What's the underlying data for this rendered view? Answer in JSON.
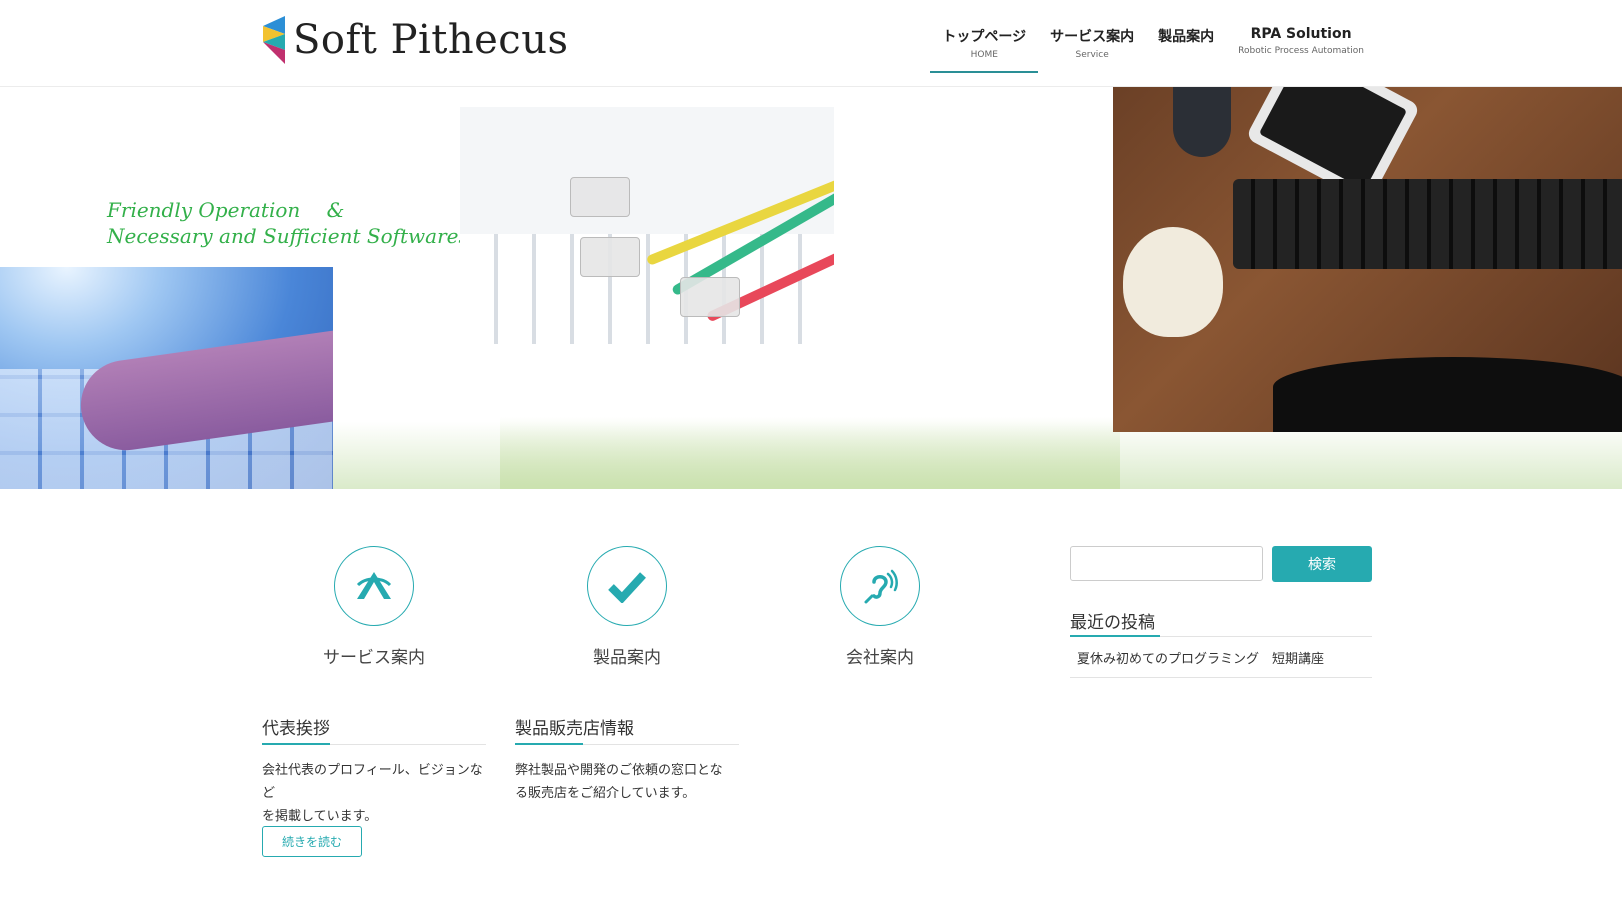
{
  "header": {
    "logo_text": "Soft Pithecus",
    "nav": [
      {
        "main": "トップページ",
        "sub": "HOME",
        "active": true
      },
      {
        "main": "サービス案内",
        "sub": "Service",
        "active": false
      },
      {
        "main": "製品案内",
        "sub": "",
        "active": false
      },
      {
        "main": "RPA Solution",
        "sub": "Robotic Process Automation",
        "active": false
      }
    ]
  },
  "hero": {
    "tagline_line1": "Friendly Operation　 &",
    "tagline_line2": "Necessary and Sufficient Softwares"
  },
  "features": [
    {
      "label": "サービス案内",
      "icon": "triangle-logo-icon"
    },
    {
      "label": "製品案内",
      "icon": "checkmark-icon"
    },
    {
      "label": "会社案内",
      "icon": "hearing-icon"
    }
  ],
  "widgets": {
    "greeting": {
      "title": "代表挨拶",
      "body_line1": "会社代表のプロフィール、ビジョンなど",
      "body_line2": "を掲載しています。",
      "button": "続きを読む"
    },
    "dealers": {
      "title": "製品販売店情報",
      "body_line1": "弊社製品や開発のご依頼の窓口とな",
      "body_line2": "る販売店をご紹介しています。"
    }
  },
  "sidebar": {
    "search_value": "",
    "search_button": "検索",
    "recent_title": "最近の投稿",
    "recent_posts": [
      "夏休み初めてのプログラミング　短期講座"
    ]
  },
  "colors": {
    "accent": "#26aab0",
    "nav_underline": "#2a8f96",
    "tagline": "#33b04a"
  }
}
